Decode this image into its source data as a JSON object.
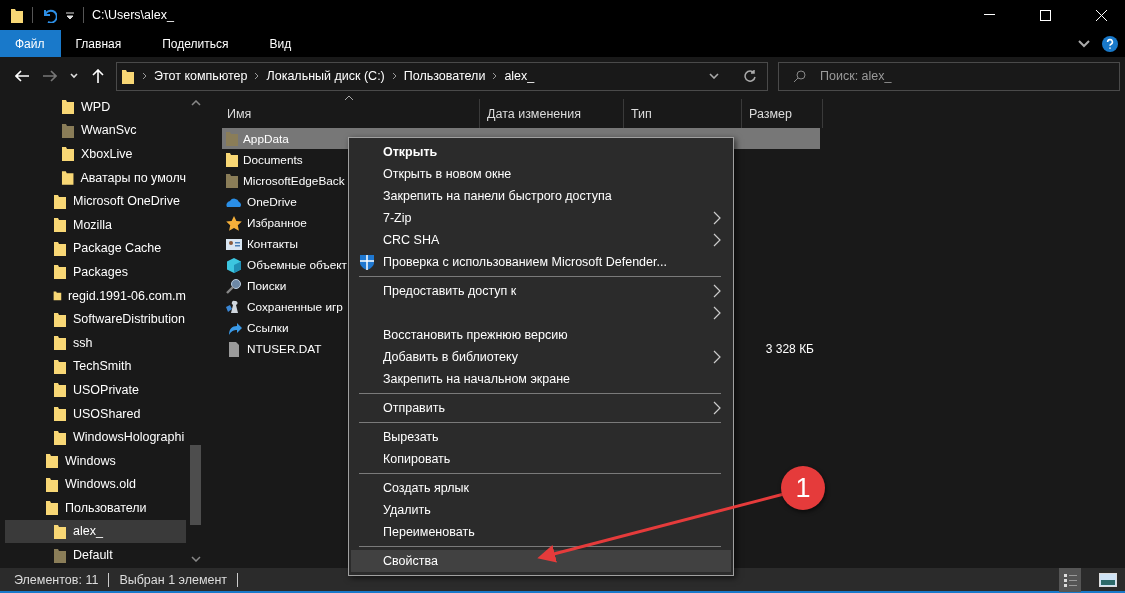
{
  "window": {
    "title": "C:\\Users\\alex_"
  },
  "ribbon": {
    "tabs": [
      {
        "label": "Файл",
        "selected": true
      },
      {
        "label": "Главная",
        "selected": false
      },
      {
        "label": "Поделиться",
        "selected": false
      },
      {
        "label": "Вид",
        "selected": false
      }
    ]
  },
  "address_bar": {
    "crumbs": [
      "Этот компьютер",
      "Локальный диск (C:)",
      "Пользователи",
      "alex_"
    ]
  },
  "search": {
    "placeholder": "Поиск: alex_"
  },
  "sidebar": {
    "tree": [
      {
        "children": [
          {
            "children": [
              {
                "name": "WPD",
                "kind": "folder",
                "selected": false
              },
              {
                "name": "WwanSvc",
                "kind": "folder-dim",
                "selected": false
              },
              {
                "name": "XboxLive",
                "kind": "folder",
                "selected": false
              },
              {
                "name": "Аватары по умолч",
                "kind": "folder",
                "selected": false
              }
            ]
          },
          {
            "name": "Microsoft OneDrive",
            "kind": "folder",
            "selected": false
          },
          {
            "name": "Mozilla",
            "kind": "folder",
            "selected": false
          },
          {
            "name": "Package Cache",
            "kind": "folder",
            "selected": false
          },
          {
            "name": "Packages",
            "kind": "folder",
            "selected": false
          },
          {
            "name": "regid.1991-06.com.m",
            "kind": "folder",
            "selected": false
          },
          {
            "name": "SoftwareDistribution",
            "kind": "folder",
            "selected": false
          },
          {
            "name": "ssh",
            "kind": "folder",
            "selected": false
          },
          {
            "name": "TechSmith",
            "kind": "folder",
            "selected": false
          },
          {
            "name": "USOPrivate",
            "kind": "folder",
            "selected": false
          },
          {
            "name": "USOShared",
            "kind": "folder",
            "selected": false
          },
          {
            "name": "WindowsHolographi",
            "kind": "folder",
            "selected": false
          }
        ]
      },
      {
        "name": "Windows",
        "kind": "folder",
        "selected": false
      },
      {
        "name": "Windows.old",
        "kind": "folder",
        "selected": false
      },
      {
        "name": "Пользователи",
        "kind": "folder",
        "selected": false,
        "children": [
          {
            "name": "alex_",
            "kind": "folder",
            "selected": true
          },
          {
            "name": "Default",
            "kind": "folder-dim",
            "selected": false
          }
        ]
      }
    ]
  },
  "table": {
    "columns": [
      "Имя",
      "Дата изменения",
      "Тип",
      "Размер"
    ],
    "rows": [
      {
        "name": "AppData",
        "kind": "folder-dim",
        "selected": true
      },
      {
        "name": "Documents",
        "kind": "folder",
        "selected": false
      },
      {
        "name": "MicrosoftEdgeBack",
        "kind": "folder-dim",
        "selected": false
      },
      {
        "name": "OneDrive",
        "kind": "cloud",
        "selected": false
      },
      {
        "name": "Избранное",
        "kind": "star",
        "selected": false
      },
      {
        "name": "Контакты",
        "kind": "contacts",
        "selected": false
      },
      {
        "name": "Объемные объект",
        "kind": "cube",
        "selected": false
      },
      {
        "name": "Поиски",
        "kind": "magnifier",
        "selected": false
      },
      {
        "name": "Сохраненные игр",
        "kind": "games",
        "selected": false
      },
      {
        "name": "Ссылки",
        "kind": "link",
        "selected": false
      },
      {
        "name": "NTUSER.DAT",
        "kind": "file",
        "selected": false,
        "size": "3 328 КБ"
      }
    ]
  },
  "context_menu": {
    "groups": [
      {
        "items": [
          {
            "kind": "plain",
            "label": "Открыть",
            "default": true,
            "submenu": false,
            "highlighted": false
          },
          {
            "kind": "plain",
            "label": "Открыть в новом окне",
            "default": false,
            "submenu": false,
            "highlighted": false
          },
          {
            "kind": "plain",
            "label": "Закрепить на панели быстрого доступа",
            "default": false,
            "submenu": false,
            "highlighted": false
          },
          {
            "kind": "plain",
            "label": "7-Zip",
            "default": false,
            "submenu": true,
            "highlighted": false
          },
          {
            "kind": "plain",
            "label": "CRC SHA",
            "default": false,
            "submenu": true,
            "highlighted": false
          },
          {
            "kind": "shield",
            "label": "Проверка с использованием Microsoft Defender...",
            "default": false,
            "submenu": false,
            "highlighted": false
          }
        ]
      },
      {
        "items": [
          {
            "kind": "plain",
            "label": "Предоставить доступ к",
            "default": false,
            "submenu": true,
            "highlighted": false
          },
          {
            "kind": "plain",
            "submenu": true,
            "highlighted": false
          },
          {
            "kind": "plain",
            "label": "Восстановить прежнюю версию",
            "default": false,
            "submenu": false,
            "highlighted": false
          },
          {
            "kind": "plain",
            "label": "Добавить в библиотеку",
            "default": false,
            "submenu": true,
            "highlighted": false
          },
          {
            "kind": "plain",
            "label": "Закрепить на начальном экране",
            "default": false,
            "submenu": false,
            "highlighted": false
          }
        ]
      },
      {
        "items": [
          {
            "kind": "plain",
            "label": "Отправить",
            "default": false,
            "submenu": true,
            "highlighted": false
          }
        ]
      },
      {
        "items": [
          {
            "kind": "plain",
            "label": "Вырезать",
            "default": false,
            "submenu": false,
            "highlighted": false
          },
          {
            "kind": "plain",
            "label": "Копировать",
            "default": false,
            "submenu": false,
            "highlighted": false
          }
        ]
      },
      {
        "items": [
          {
            "kind": "plain",
            "label": "Создать ярлык",
            "default": false,
            "submenu": false,
            "highlighted": false
          },
          {
            "kind": "plain",
            "label": "Удалить",
            "default": false,
            "submenu": false,
            "highlighted": false
          },
          {
            "kind": "plain",
            "label": "Переименовать",
            "default": false,
            "submenu": false,
            "highlighted": false
          }
        ]
      },
      {
        "items": [
          {
            "kind": "plain",
            "label": "Свойства",
            "default": false,
            "submenu": false,
            "highlighted": true
          }
        ]
      }
    ]
  },
  "annotation": {
    "number": "1"
  },
  "status_bar": {
    "items": [
      "Элементов: 11",
      "Выбран 1 элемент"
    ]
  }
}
